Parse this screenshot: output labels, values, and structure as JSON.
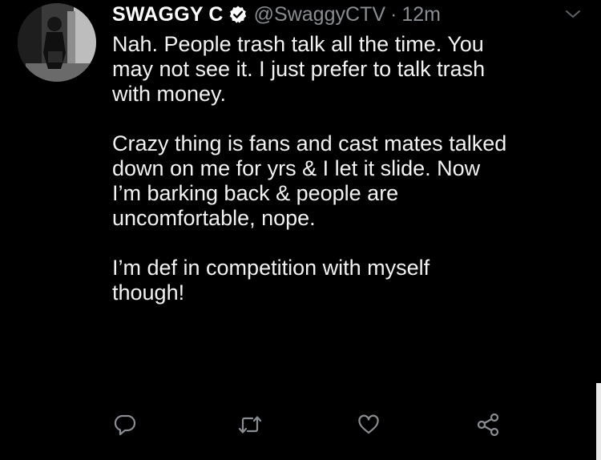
{
  "tweet": {
    "display_name": "SWAGGY C",
    "handle": "@SwaggyCTV",
    "separator": "·",
    "time": "12m",
    "paragraphs": [
      {
        "lines": [
          "Nah. People trash talk all the time. You",
          "may not see it. I just prefer to talk trash",
          "with money."
        ]
      },
      {
        "lines": [
          "Crazy thing is fans and cast mates talked",
          "down on me for yrs & I let it slide. Now",
          "I’m barking back & people are",
          "uncomfortable, nope."
        ]
      },
      {
        "lines": [
          "I’m def in competition with myself",
          "though!"
        ]
      }
    ]
  },
  "icons": {
    "verified": "verified-badge-icon",
    "caret": "chevron-down-icon",
    "reply": "reply-icon",
    "retweet": "retweet-icon",
    "like": "heart-icon",
    "share": "share-icon"
  },
  "colors": {
    "background": "#000000",
    "text": "#f2f2f2",
    "muted": "#8a8d91",
    "icon": "#8a8d91"
  }
}
